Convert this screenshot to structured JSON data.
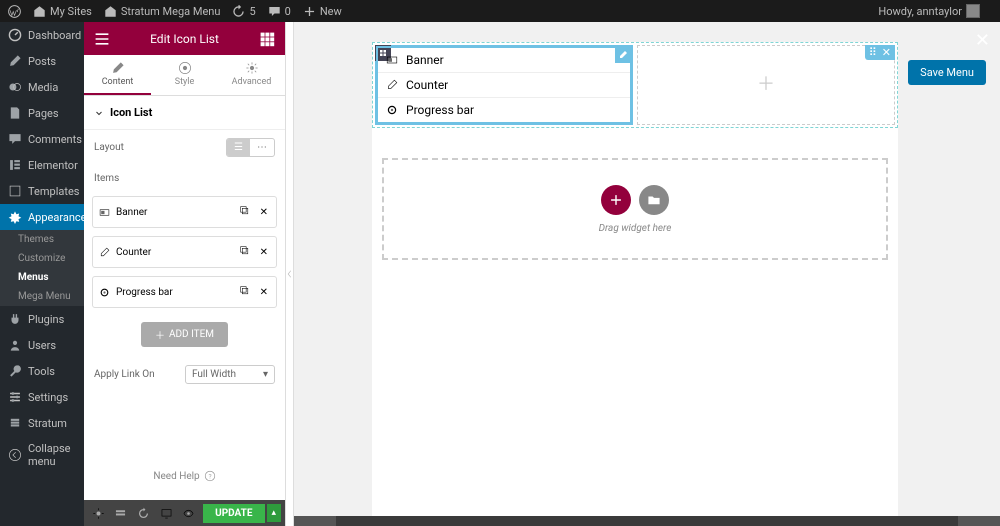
{
  "adminbar": {
    "my_sites": "My Sites",
    "site_name": "Stratum Mega Menu",
    "updates": "5",
    "comments": "0",
    "new": "New",
    "howdy": "Howdy, anntaylor"
  },
  "wp_menu": {
    "dashboard": "Dashboard",
    "posts": "Posts",
    "media": "Media",
    "pages": "Pages",
    "comments": "Comments",
    "elementor": "Elementor",
    "templates": "Templates",
    "appearance": "Appearance",
    "themes": "Themes",
    "customize": "Customize",
    "menus": "Menus",
    "mega_menu": "Mega Menu",
    "plugins": "Plugins",
    "users": "Users",
    "tools": "Tools",
    "settings": "Settings",
    "stratum": "Stratum",
    "collapse": "Collapse menu"
  },
  "panel": {
    "title": "Edit Icon List",
    "tab_content": "Content",
    "tab_style": "Style",
    "tab_advanced": "Advanced",
    "section": "Icon List",
    "layout_label": "Layout",
    "items_label": "Items",
    "items": [
      "Banner",
      "Counter",
      "Progress bar"
    ],
    "add_item": "ADD ITEM",
    "apply_link": "Apply Link On",
    "apply_link_val": "Full Width",
    "need_help": "Need Help",
    "update": "UPDATE"
  },
  "canvas": {
    "save_menu": "Save Menu",
    "list": [
      "Banner",
      "Counter",
      "Progress bar"
    ],
    "drag_hint": "Drag widget here"
  }
}
